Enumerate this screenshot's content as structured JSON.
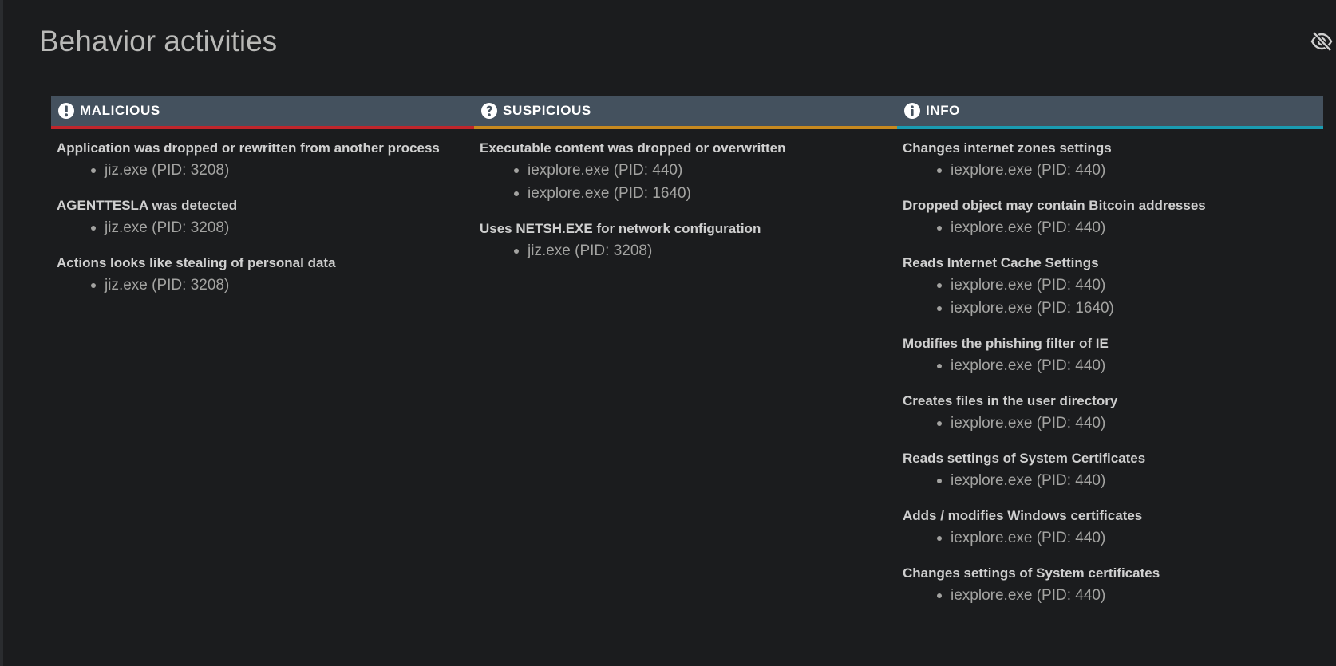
{
  "page": {
    "title": "Behavior activities"
  },
  "icons": {
    "hide": "eye-slash-icon",
    "malicious": "exclamation-circle-icon",
    "suspicious": "question-circle-icon",
    "info": "info-circle-icon"
  },
  "colors": {
    "malicious": "#c0252b",
    "suspicious": "#c8891f",
    "info": "#1a9bb1",
    "header_bg": "#44515e"
  },
  "columns": [
    {
      "title": "MALICIOUS",
      "activities": [
        {
          "title": "Application was dropped or rewritten from another process",
          "processes": [
            "jiz.exe (PID: 3208)"
          ]
        },
        {
          "title": "AGENTTESLA was detected",
          "processes": [
            "jiz.exe (PID: 3208)"
          ]
        },
        {
          "title": "Actions looks like stealing of personal data",
          "processes": [
            "jiz.exe (PID: 3208)"
          ]
        }
      ]
    },
    {
      "title": "SUSPICIOUS",
      "activities": [
        {
          "title": "Executable content was dropped or overwritten",
          "processes": [
            "iexplore.exe (PID: 440)",
            "iexplore.exe (PID: 1640)"
          ]
        },
        {
          "title": "Uses NETSH.EXE for network configuration",
          "processes": [
            "jiz.exe (PID: 3208)"
          ]
        }
      ]
    },
    {
      "title": "INFO",
      "activities": [
        {
          "title": "Changes internet zones settings",
          "processes": [
            "iexplore.exe (PID: 440)"
          ]
        },
        {
          "title": "Dropped object may contain Bitcoin addresses",
          "processes": [
            "iexplore.exe (PID: 440)"
          ]
        },
        {
          "title": "Reads Internet Cache Settings",
          "processes": [
            "iexplore.exe (PID: 440)",
            "iexplore.exe (PID: 1640)"
          ]
        },
        {
          "title": "Modifies the phishing filter of IE",
          "processes": [
            "iexplore.exe (PID: 440)"
          ]
        },
        {
          "title": "Creates files in the user directory",
          "processes": [
            "iexplore.exe (PID: 440)"
          ]
        },
        {
          "title": "Reads settings of System Certificates",
          "processes": [
            "iexplore.exe (PID: 440)"
          ]
        },
        {
          "title": "Adds / modifies Windows certificates",
          "processes": [
            "iexplore.exe (PID: 440)"
          ]
        },
        {
          "title": "Changes settings of System certificates",
          "processes": [
            "iexplore.exe (PID: 440)"
          ]
        }
      ]
    }
  ]
}
